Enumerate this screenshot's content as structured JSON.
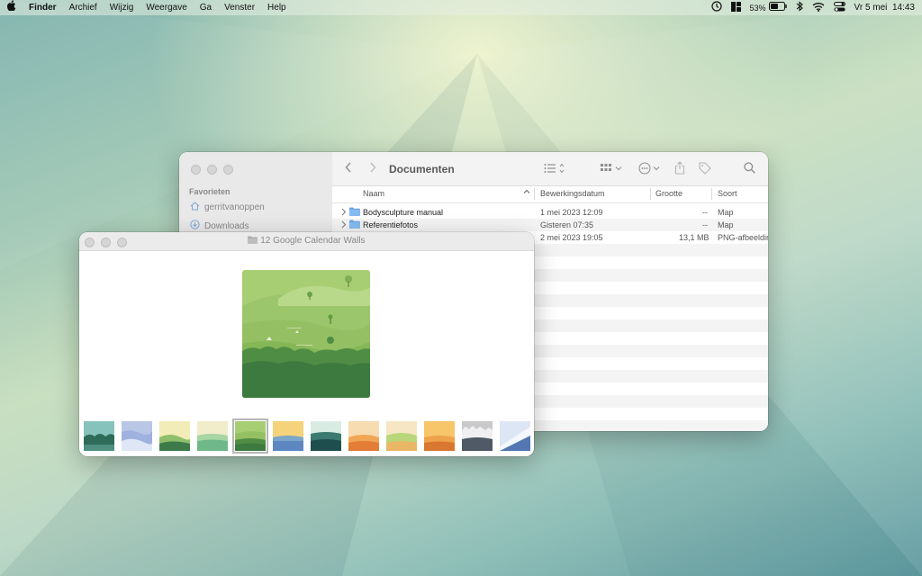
{
  "menubar": {
    "apple_icon": "apple-logo-icon",
    "app": "Finder",
    "items": [
      "Archief",
      "Wijzig",
      "Weergave",
      "Ga",
      "Venster",
      "Help"
    ],
    "battery": "53%",
    "datetime": "Vr 5 mei  14:43"
  },
  "finder": {
    "sidebar": {
      "section": "Favorieten",
      "items": [
        {
          "label": "gerritvanoppen",
          "icon": "home-icon"
        },
        {
          "label": "Downloads",
          "icon": "download-icon"
        }
      ]
    },
    "toolbar": {
      "title": "Documenten",
      "back_icon": "chevron-left-icon",
      "forward_icon": "chevron-right-icon"
    },
    "columns": {
      "name": "Naam",
      "date": "Bewerkingsdatum",
      "size": "Grootte",
      "kind": "Soort"
    },
    "rows": [
      {
        "name": "Bodysculpture manual",
        "date": "1 mei 2023 12:09",
        "size": "--",
        "kind": "Map"
      },
      {
        "name": "Referentiefotos",
        "date": "Gisteren 07:35",
        "size": "--",
        "kind": "Map"
      },
      {
        "name": "",
        "date": "2 mei 2023 19:05",
        "size": "13,1 MB",
        "kind": "PNG-afbeelding"
      }
    ]
  },
  "preview": {
    "title": "12 Google Calendar Walls",
    "thumb_count": 12,
    "selected_thumb": 5
  }
}
